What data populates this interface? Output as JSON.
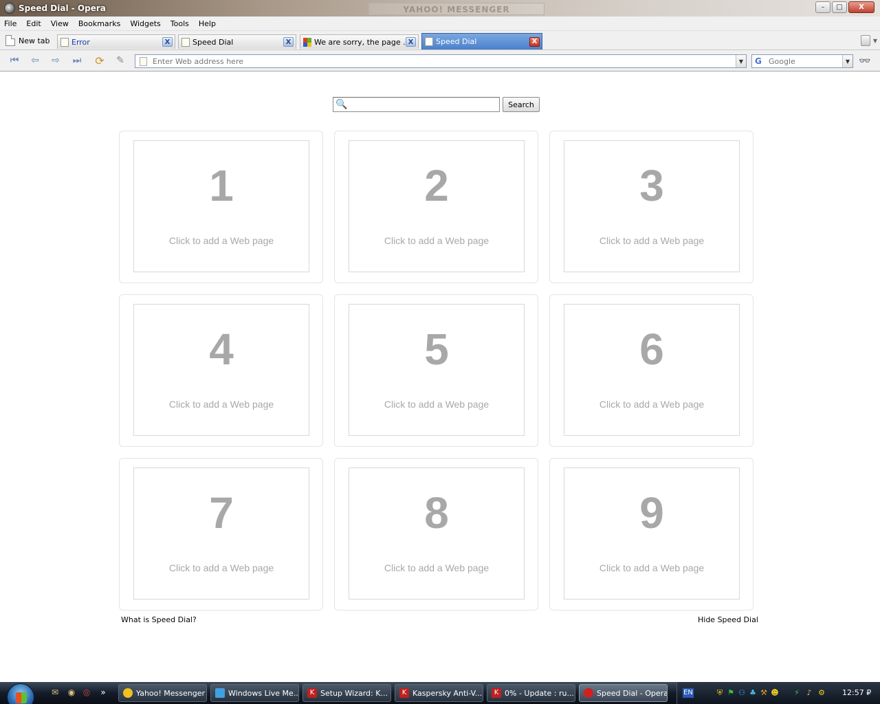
{
  "window": {
    "title": "Speed Dial - Opera",
    "ghost_title": "YAHOO! MESSENGER",
    "minimize": "–",
    "maximize": "□",
    "close": "X"
  },
  "menu": [
    "File",
    "Edit",
    "View",
    "Bookmarks",
    "Widgets",
    "Tools",
    "Help"
  ],
  "tabs": {
    "new_tab_label": "New tab",
    "items": [
      {
        "label": "Error",
        "close": "X"
      },
      {
        "label": "Speed Dial",
        "close": "X"
      },
      {
        "label": "We are sorry, the page ...",
        "close": "X"
      },
      {
        "label": "Speed Dial",
        "close": "X"
      }
    ]
  },
  "toolbar": {
    "address_placeholder": "Enter Web address here",
    "search_placeholder": "Google",
    "search_engine_icon": "G",
    "dropdown": "▼"
  },
  "speed_dial": {
    "search_button": "Search",
    "dials": [
      {
        "number": "1",
        "hint": "Click to add a Web page"
      },
      {
        "number": "2",
        "hint": "Click to add a Web page"
      },
      {
        "number": "3",
        "hint": "Click to add a Web page"
      },
      {
        "number": "4",
        "hint": "Click to add a Web page"
      },
      {
        "number": "5",
        "hint": "Click to add a Web page"
      },
      {
        "number": "6",
        "hint": "Click to add a Web page"
      },
      {
        "number": "7",
        "hint": "Click to add a Web page"
      },
      {
        "number": "8",
        "hint": "Click to add a Web page"
      },
      {
        "number": "9",
        "hint": "Click to add a Web page"
      }
    ],
    "what_is_link": "What is Speed Dial?",
    "hide_link": "Hide Speed Dial"
  },
  "taskbar": {
    "items": [
      {
        "label": "Yahoo! Messenger"
      },
      {
        "label": "Windows Live Me..."
      },
      {
        "label": "Setup Wizard: K..."
      },
      {
        "label": "Kaspersky Anti-V..."
      },
      {
        "label": "0% - Update : ru..."
      },
      {
        "label": "Speed Dial - Opera"
      }
    ],
    "quick_launch_more": "»",
    "language": "EN",
    "clock": "12:57 ₽"
  }
}
